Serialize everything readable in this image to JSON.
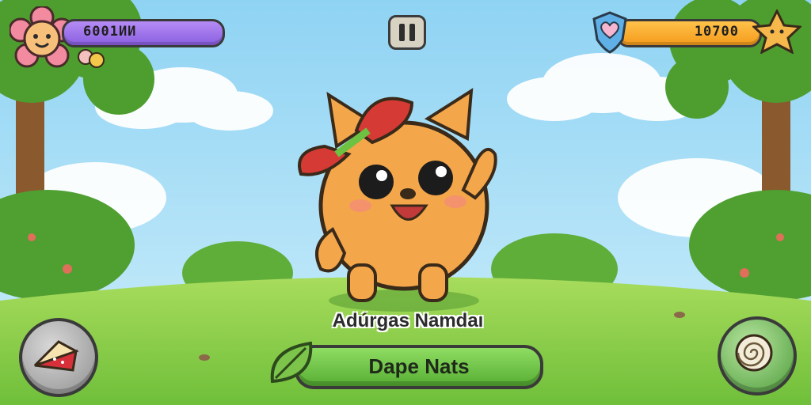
{
  "hud": {
    "left_bar_value": "6001ИИ",
    "right_bar_value": "10700",
    "left_bar_color": "#8a5ee0",
    "right_bar_color": "#f49b1b"
  },
  "character": {
    "name": "Adúrgas Namdaı"
  },
  "action_button": {
    "label": "Dape Nats",
    "color": "#56ae33"
  },
  "icons": {
    "avatar": "flower-face-icon",
    "pet_mini": "pet-mini-icon",
    "heart": "heart-shield-icon",
    "star_pet": "star-pet-icon",
    "pause": "pause-icon",
    "left_corner": "cake-slice-icon",
    "right_corner": "swirl-shell-icon",
    "leaf": "leaf-icon"
  }
}
